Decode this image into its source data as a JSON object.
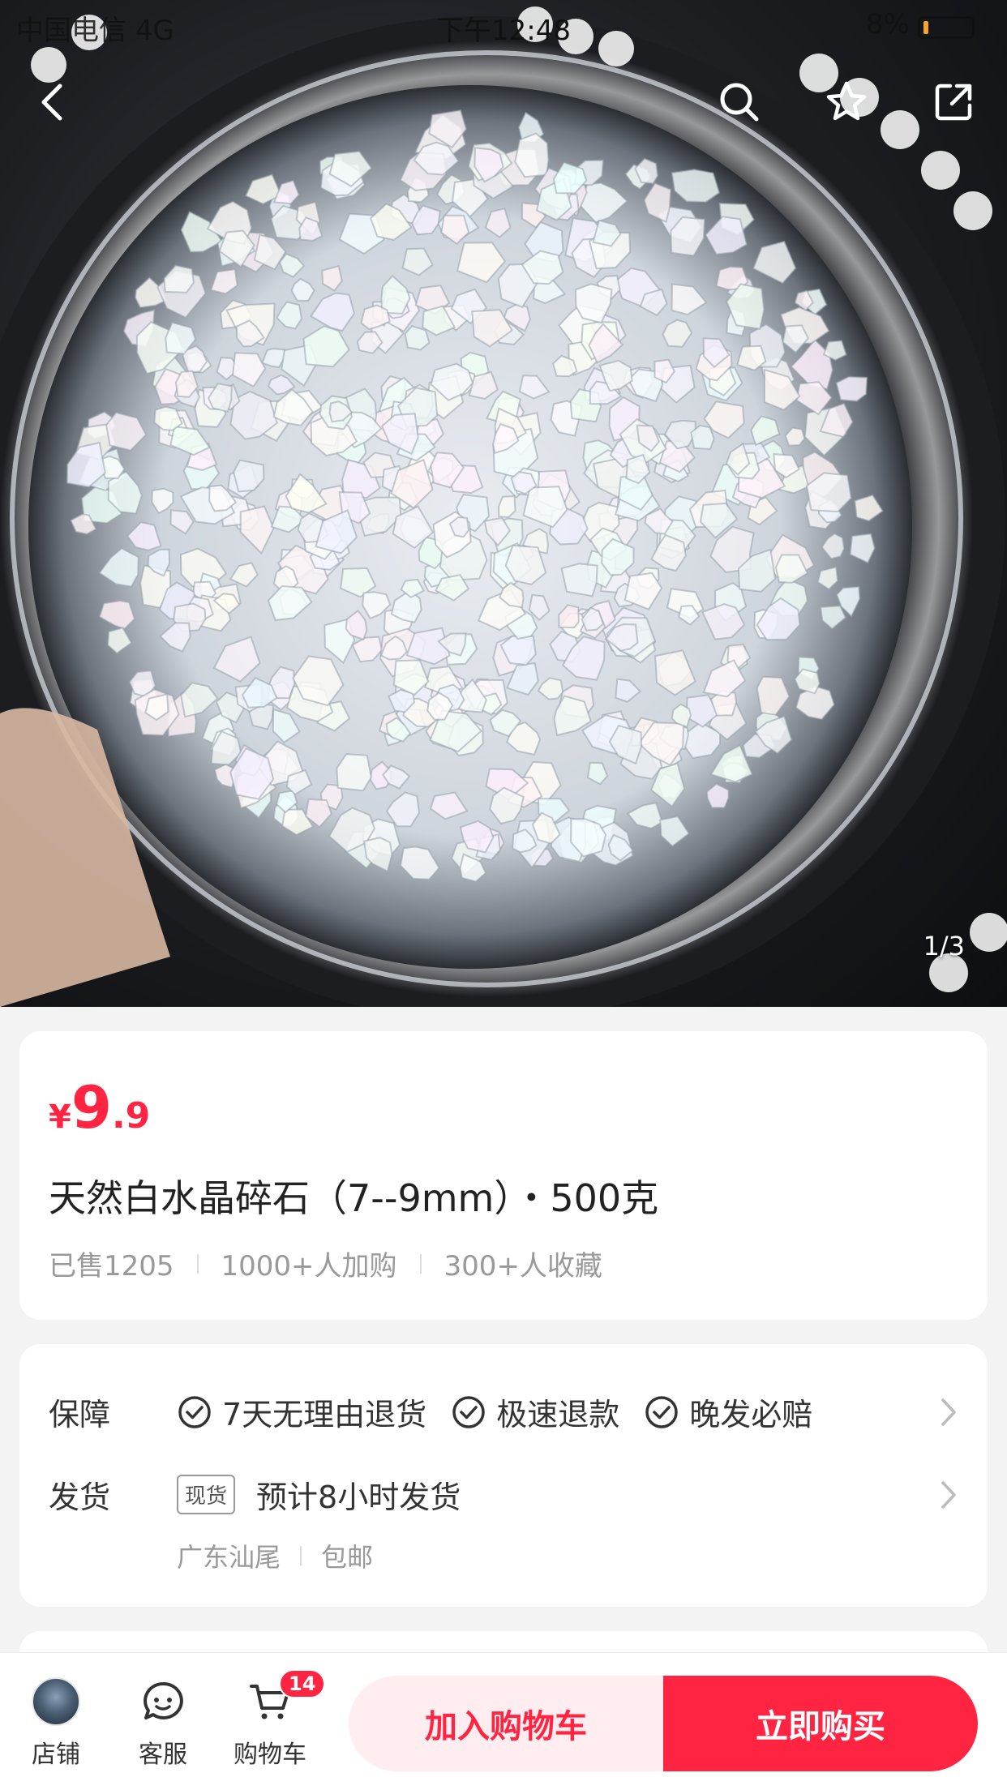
{
  "status_bar": {
    "carrier": "中国电信 4G",
    "time": "下午12:48",
    "battery": "8%"
  },
  "hero": {
    "pager": "1/3",
    "icons": [
      "back-icon",
      "search-icon",
      "star-icon",
      "share-icon"
    ]
  },
  "product": {
    "currency": "¥",
    "price_int": "9",
    "price_dec": ".9",
    "title": "天然白水晶碎石（7--9mm）・500克",
    "stats": [
      "已售1205",
      "1000+人加购",
      "300+人收藏"
    ]
  },
  "service": {
    "guarantee_label": "保障",
    "guarantees": [
      "7天无理由退货",
      "极速退款",
      "晚发必赔"
    ],
    "shipping_label": "发货",
    "stock_tag": "现货",
    "shipping_text": "预计8小时发货",
    "origin": "广东汕尾",
    "postage": "包邮"
  },
  "bottom_bar": {
    "shop": "店铺",
    "service": "客服",
    "cart": "购物车",
    "cart_count": "14",
    "add_to_cart": "加入购物车",
    "buy_now": "立即购买"
  },
  "colors": {
    "accent": "#ff2442",
    "accent_light": "#ffedf0"
  }
}
